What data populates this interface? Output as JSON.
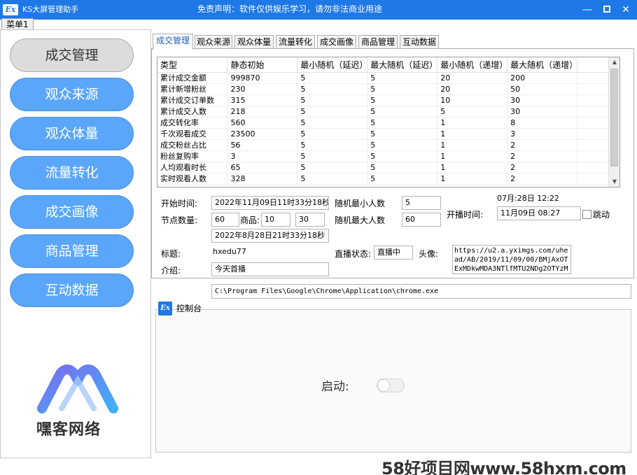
{
  "window": {
    "icon_text": "Ex",
    "title": "KS大屏管理助手",
    "disclaimer": "免责声明：软件仅供娱乐学习，请勿非法商业用途"
  },
  "menu": {
    "tab_label": "菜单1"
  },
  "nav": [
    {
      "label": "成交管理",
      "active": true
    },
    {
      "label": "观众来源"
    },
    {
      "label": "观众体量"
    },
    {
      "label": "流量转化"
    },
    {
      "label": "成交画像"
    },
    {
      "label": "商品管理"
    },
    {
      "label": "互动数据"
    }
  ],
  "logo": {
    "text": "嘿客网络",
    "colors": [
      "#7b6cf0",
      "#3fb0f5"
    ]
  },
  "tabs": [
    "成交管理",
    "观众来源",
    "观众体量",
    "流量转化",
    "成交画像",
    "商品管理",
    "互动数据"
  ],
  "grid": {
    "headers": [
      "类型",
      "静态初始",
      "最小随机（延迟）",
      "最大随机（延迟）",
      "最小随机（递增）",
      "最大随机（递增）"
    ],
    "rows": [
      [
        "累计成交金额",
        "999870",
        "5",
        "5",
        "20",
        "200"
      ],
      [
        "累计新增粉丝",
        "230",
        "5",
        "5",
        "20",
        "50"
      ],
      [
        "累计成交订单数",
        "315",
        "5",
        "5",
        "10",
        "30"
      ],
      [
        "累计成交人数",
        "218",
        "5",
        "5",
        "5",
        "30"
      ],
      [
        "成交转化率",
        "560",
        "5",
        "5",
        "1",
        "8"
      ],
      [
        "千次观看成交",
        "23500",
        "5",
        "5",
        "1",
        "3"
      ],
      [
        "成交粉丝占比",
        "56",
        "5",
        "5",
        "1",
        "2"
      ],
      [
        "粉丝复购率",
        "3",
        "5",
        "5",
        "1",
        "2"
      ],
      [
        "人均观看时长",
        "65",
        "5",
        "5",
        "1",
        "2"
      ],
      [
        "实时观看人数",
        "328",
        "5",
        "5",
        "1",
        "2"
      ]
    ]
  },
  "form": {
    "start_time_label": "开始时间:",
    "start_time": "2022年11月09日11时33分18秒",
    "random_min_label": "随机最小人数",
    "random_min": "5",
    "clock": "07月:28日 12:22",
    "node_count_label": "节点数量:",
    "node_count": "60",
    "goods_label": "商品:",
    "goods_a": "10",
    "goods_b": "30",
    "random_max_label": "随机最大人数",
    "random_max": "60",
    "open_time_label": "开播时间:",
    "open_time": "11月09日 08:27",
    "jump_label": "跳动",
    "end_time": "2022年8月28日21时33分18秒",
    "title_label": "标题:",
    "title_value": "hxedu77",
    "live_status_label": "直播状态:",
    "live_status": "直播中",
    "avatar_label": "头像:",
    "avatar_url": "https://u2.a.yximgs.com/uhead/AB/2019/11/09/00/BMjAxOTExMDkwMDA3NTlfMTU2NDg2OTYzM",
    "intro_label": "介绍:",
    "intro_value": "今天首播"
  },
  "chrome_path": "C:\\Program Files\\Google\\Chrome\\Application\\chrome.exe",
  "console": {
    "icon_text": "Ex",
    "title": "控制台",
    "start_label": "启动:",
    "start_on": false
  },
  "watermark": "58好项目网www.58hxm.com"
}
